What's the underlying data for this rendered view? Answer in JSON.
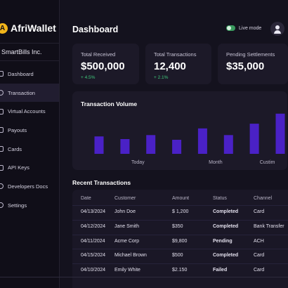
{
  "brand": {
    "logo_letter": "A",
    "name": "AfriWallet"
  },
  "org_name": "SmartBills Inc.",
  "nav": [
    {
      "label": "Dashboard",
      "icon": "grid-icon"
    },
    {
      "label": "Transaction",
      "icon": "transaction-icon"
    },
    {
      "label": "Virtual Accounts",
      "icon": "wallet-icon"
    },
    {
      "label": "Payouts",
      "icon": "payout-icon"
    },
    {
      "label": "Cards",
      "icon": "card-icon"
    },
    {
      "label": "API Keys",
      "icon": "key-icon"
    },
    {
      "label": "Developers Docs",
      "icon": "docs-icon"
    },
    {
      "label": "Settings",
      "icon": "gear-icon"
    }
  ],
  "active_nav": "Transaction",
  "header": {
    "title": "Dashboard",
    "live_mode_label": "Live mode"
  },
  "kpis": [
    {
      "label": "Total Received",
      "value": "$500,000",
      "change": "+ 4.5%"
    },
    {
      "label": "Total Transactions",
      "value": "12,400",
      "change": "+ 2.1%"
    },
    {
      "label": "Pending Settlements",
      "value": "$35,000",
      "change": ""
    }
  ],
  "chart_data": {
    "type": "bar",
    "title": "Transaction Volume",
    "categories": [
      "",
      "Today",
      "",
      "",
      "Month",
      "",
      "Custim",
      ""
    ],
    "values": [
      26,
      22,
      28,
      21,
      38,
      28,
      45,
      60
    ],
    "ylim": [
      0,
      65
    ],
    "grid": false,
    "bar_color": "#4a21c6"
  },
  "transactions": {
    "title": "Recent Transactions",
    "columns": [
      "Date",
      "Customer",
      "Amount",
      "Status",
      "Channel"
    ],
    "rows": [
      [
        "04/13/2024",
        "John Doe",
        "$ 1,200",
        "Completed",
        "Card"
      ],
      [
        "04/12/2024",
        "Jane Smith",
        "$350",
        "Completed",
        "Bank Transfer"
      ],
      [
        "04/11/2024",
        "Acme Corp",
        "$9,800",
        "Pending",
        "ACH"
      ],
      [
        "04/15/2024",
        "Michael Brown",
        "$500",
        "Completed",
        "Card"
      ],
      [
        "04/10/2024",
        "Emily White",
        "$2.150",
        "Failed",
        "Card"
      ]
    ]
  },
  "colors": {
    "background": "#14121e",
    "card": "#1c1928",
    "accent_bar": "#4a21c6",
    "brand_yellow": "#f2b51b",
    "positive": "#3fc77a"
  }
}
